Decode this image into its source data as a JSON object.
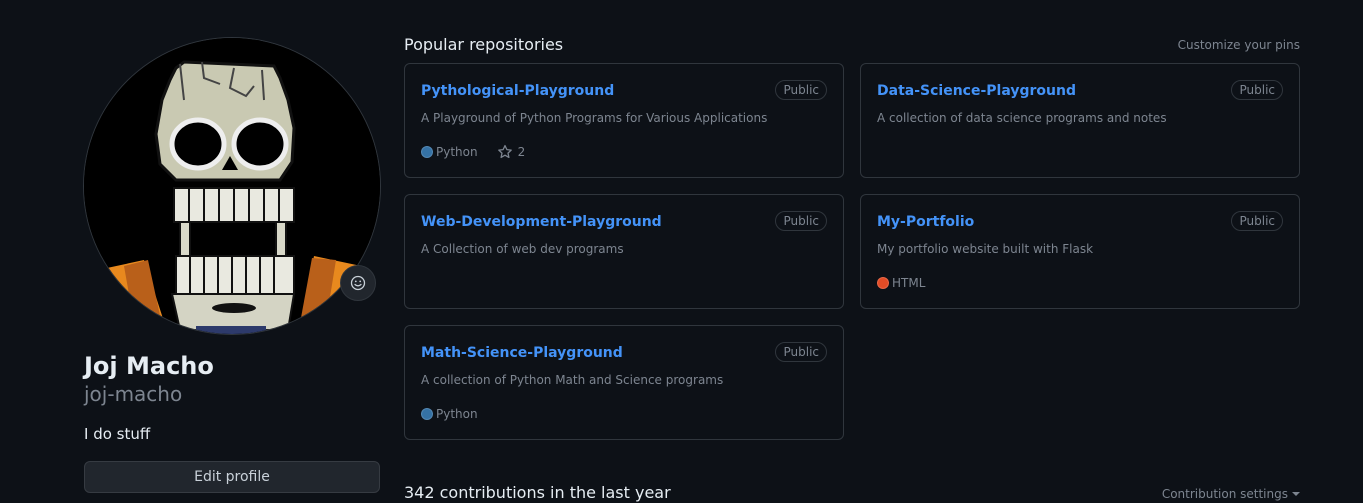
{
  "profile": {
    "display_name": "Joj Macho",
    "username": "joj-macho",
    "bio": "I do stuff",
    "edit_label": "Edit profile",
    "avatar_icon": "skull-avatar",
    "status_icon": "smiley-icon"
  },
  "pinned": {
    "title": "Popular repositories",
    "customize_label": "Customize your pins",
    "repos": [
      {
        "name": "Pythological-Playground",
        "visibility": "Public",
        "description": "A Playground of Python Programs for Various Applications",
        "language": "Python",
        "language_color": "#3572A5",
        "stars": "2"
      },
      {
        "name": "Data-Science-Playground",
        "visibility": "Public",
        "description": "A collection of data science programs and notes"
      },
      {
        "name": "Web-Development-Playground",
        "visibility": "Public",
        "description": "A Collection of web dev programs"
      },
      {
        "name": "My-Portfolio",
        "visibility": "Public",
        "description": "My portfolio website built with Flask",
        "language": "HTML",
        "language_color": "#e34c26"
      },
      {
        "name": "Math-Science-Playground",
        "visibility": "Public",
        "description": "A collection of Python Math and Science programs",
        "language": "Python",
        "language_color": "#3572A5"
      }
    ]
  },
  "contributions": {
    "title": "342 contributions in the last year",
    "settings_label": "Contribution settings"
  },
  "colors": {
    "background": "#0d1117",
    "border": "#30363d",
    "link": "#4493f8",
    "muted": "#7d8590"
  }
}
